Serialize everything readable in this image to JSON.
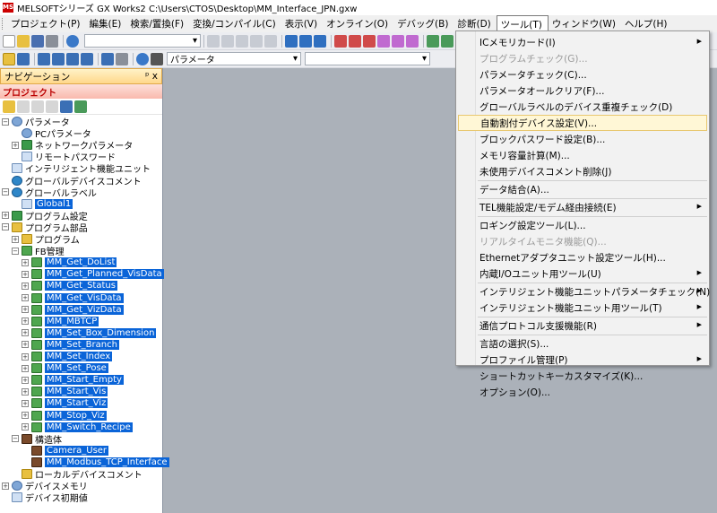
{
  "app": {
    "title": "MELSOFTシリーズ GX Works2 C:\\Users\\CTOS\\Desktop\\MM_Interface_JPN.gxw",
    "icon_text": "MS"
  },
  "menubar": [
    "プロジェクト(P)",
    "編集(E)",
    "検索/置換(F)",
    "変換/コンパイル(C)",
    "表示(V)",
    "オンライン(O)",
    "デバッグ(B)",
    "診断(D)",
    "ツール(T)",
    "ウィンドウ(W)",
    "ヘルプ(H)"
  ],
  "toolbar": {
    "combo2_text": "パラメータ"
  },
  "nav": {
    "title": "ナビゲーション",
    "pin": "ᵖ x",
    "section": "プロジェクト",
    "tree": [
      {
        "label": "パラメータ",
        "ind": 0,
        "exp": "−",
        "icon": "gear"
      },
      {
        "label": "PCパラメータ",
        "ind": 1,
        "exp": "",
        "icon": "gear"
      },
      {
        "label": "ネットワークパラメータ",
        "ind": 1,
        "exp": "+",
        "icon": "net"
      },
      {
        "label": "リモートパスワード",
        "ind": 1,
        "exp": "",
        "icon": "doc"
      },
      {
        "label": "インテリジェント機能ユニット",
        "ind": 0,
        "exp": "",
        "icon": "doc"
      },
      {
        "label": "グローバルデバイスコメント",
        "ind": 0,
        "exp": "",
        "icon": "globe"
      },
      {
        "label": "グローバルラベル",
        "ind": 0,
        "exp": "−",
        "icon": "globe"
      },
      {
        "label": "Global1",
        "ind": 1,
        "exp": "",
        "icon": "doc",
        "sel": true
      },
      {
        "label": "プログラム設定",
        "ind": 0,
        "exp": "+",
        "icon": "net"
      },
      {
        "label": "プログラム部品",
        "ind": 0,
        "exp": "−",
        "icon": "folder"
      },
      {
        "label": "プログラム",
        "ind": 1,
        "exp": "+",
        "icon": "folder"
      },
      {
        "label": "FB管理",
        "ind": 1,
        "exp": "−",
        "icon": "fb"
      },
      {
        "label": "MM_Get_DoList",
        "ind": 2,
        "exp": "+",
        "icon": "fb",
        "sel": true
      },
      {
        "label": "MM_Get_Planned_VisData",
        "ind": 2,
        "exp": "+",
        "icon": "fb",
        "sel": true
      },
      {
        "label": "MM_Get_Status",
        "ind": 2,
        "exp": "+",
        "icon": "fb",
        "sel": true
      },
      {
        "label": "MM_Get_VisData",
        "ind": 2,
        "exp": "+",
        "icon": "fb",
        "sel": true
      },
      {
        "label": "MM_Get_VizData",
        "ind": 2,
        "exp": "+",
        "icon": "fb",
        "sel": true
      },
      {
        "label": "MM_MBTCP",
        "ind": 2,
        "exp": "+",
        "icon": "fb",
        "sel": true
      },
      {
        "label": "MM_Set_Box_Dimension",
        "ind": 2,
        "exp": "+",
        "icon": "fb",
        "sel": true
      },
      {
        "label": "MM_Set_Branch",
        "ind": 2,
        "exp": "+",
        "icon": "fb",
        "sel": true
      },
      {
        "label": "MM_Set_Index",
        "ind": 2,
        "exp": "+",
        "icon": "fb",
        "sel": true
      },
      {
        "label": "MM_Set_Pose",
        "ind": 2,
        "exp": "+",
        "icon": "fb",
        "sel": true
      },
      {
        "label": "MM_Start_Empty",
        "ind": 2,
        "exp": "+",
        "icon": "fb",
        "sel": true
      },
      {
        "label": "MM_Start_Vis",
        "ind": 2,
        "exp": "+",
        "icon": "fb",
        "sel": true
      },
      {
        "label": "MM_Start_Viz",
        "ind": 2,
        "exp": "+",
        "icon": "fb",
        "sel": true
      },
      {
        "label": "MM_Stop_Viz",
        "ind": 2,
        "exp": "+",
        "icon": "fb",
        "sel": true
      },
      {
        "label": "MM_Switch_Recipe",
        "ind": 2,
        "exp": "+",
        "icon": "fb",
        "sel": true
      },
      {
        "label": "構造体",
        "ind": 1,
        "exp": "−",
        "icon": "struct"
      },
      {
        "label": "Camera_User",
        "ind": 2,
        "exp": "",
        "icon": "struct",
        "sel": true
      },
      {
        "label": "MM_Modbus_TCP_Interface",
        "ind": 2,
        "exp": "",
        "icon": "struct",
        "sel": true
      },
      {
        "label": "ローカルデバイスコメント",
        "ind": 1,
        "exp": "",
        "icon": "folder"
      },
      {
        "label": "デバイスメモリ",
        "ind": 0,
        "exp": "+",
        "icon": "gear"
      },
      {
        "label": "デバイス初期値",
        "ind": 0,
        "exp": "",
        "icon": "doc"
      }
    ]
  },
  "tools_menu": {
    "items": [
      {
        "label": "ICメモリカード(I)",
        "sub": true
      },
      {
        "label": "プログラムチェック(G)...",
        "disabled": true
      },
      {
        "label": "パラメータチェック(C)..."
      },
      {
        "label": "パラメータオールクリア(F)..."
      },
      {
        "label": "グローバルラベルのデバイス重複チェック(D)"
      },
      {
        "label": "自動割付デバイス設定(V)...",
        "hl": true
      },
      {
        "label": "ブロックパスワード設定(B)..."
      },
      {
        "label": "メモリ容量計算(M)..."
      },
      {
        "label": "未使用デバイスコメント削除(J)",
        "sep_after": true
      },
      {
        "label": "データ結合(A)...",
        "sep_after": true
      },
      {
        "label": "TEL機能設定/モデム経由接続(E)",
        "sub": true,
        "sep_after": true
      },
      {
        "label": "ロギング設定ツール(L)..."
      },
      {
        "label": "リアルタイムモニタ機能(Q)...",
        "disabled": true
      },
      {
        "label": "Ethernetアダプタユニット設定ツール(H)..."
      },
      {
        "label": "内蔵I/Oユニット用ツール(U)",
        "sub": true,
        "sep_after": true
      },
      {
        "label": "インテリジェント機能ユニットパラメータチェック(N)",
        "sub": true
      },
      {
        "label": "インテリジェント機能ユニット用ツール(T)",
        "sub": true,
        "sep_after": true
      },
      {
        "label": "通信プロトコル支援機能(R)",
        "sub": true,
        "sep_after": true
      },
      {
        "label": "言語の選択(S)..."
      },
      {
        "label": "プロファイル管理(P)",
        "sub": true
      },
      {
        "label": "ショートカットキーカスタマイズ(K)..."
      },
      {
        "label": "オプション(O)..."
      }
    ]
  }
}
